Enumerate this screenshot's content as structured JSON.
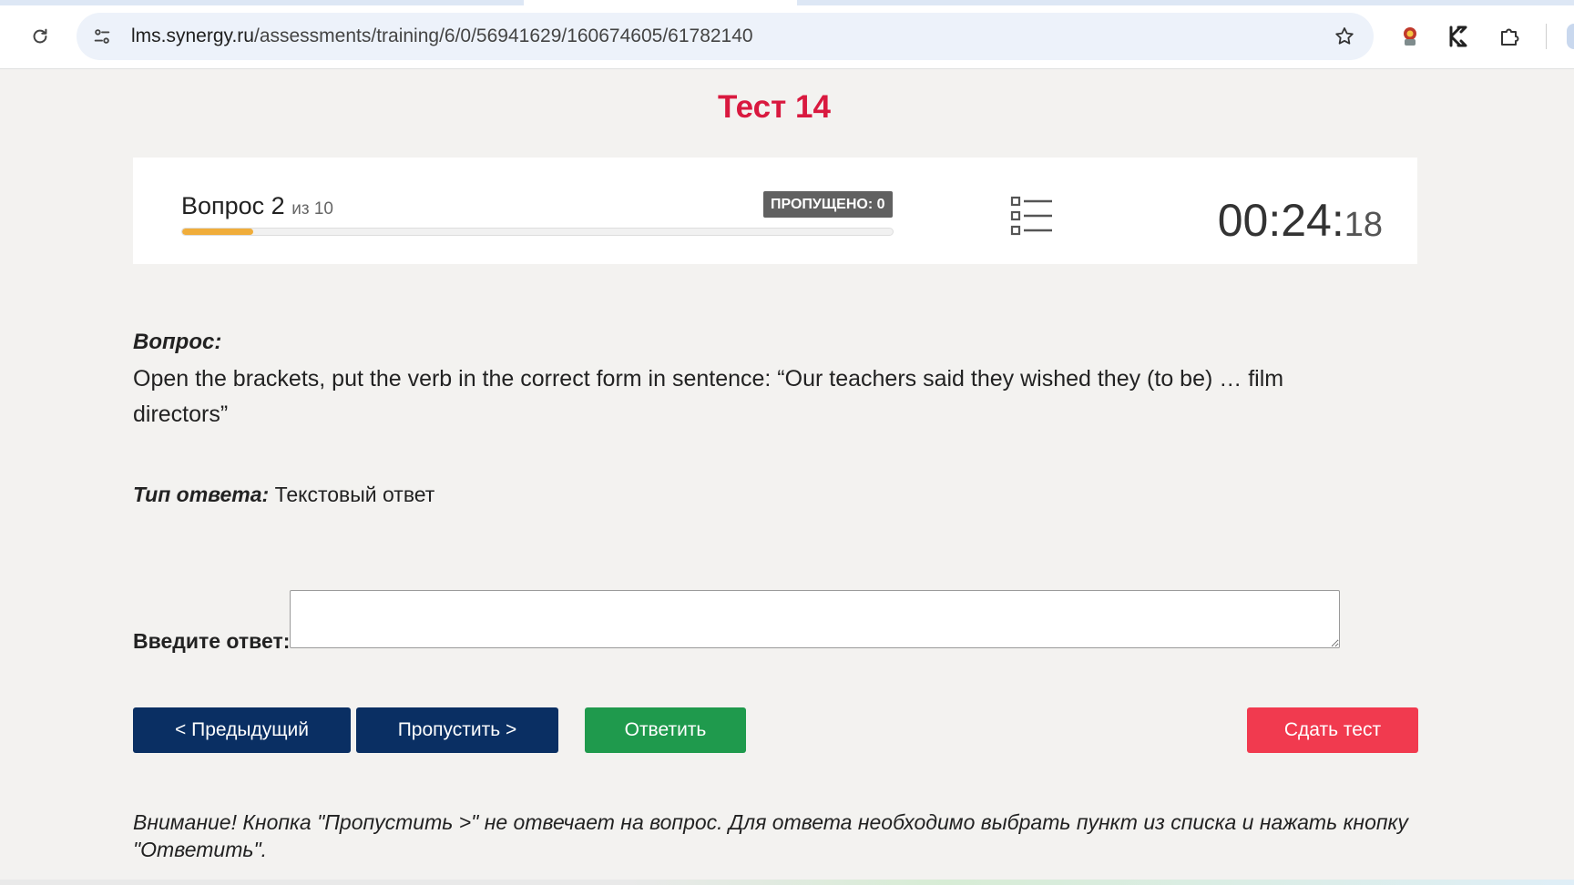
{
  "browser": {
    "url_host": "lms.synergy.ru",
    "url_path": "/assessments/training/6/0/56941629/160674605/61782140",
    "icons": [
      "reload-icon",
      "site-info-icon",
      "bookmark-star-icon",
      "extension-icon",
      "kaspersky-icon",
      "puzzle-icon"
    ]
  },
  "page": {
    "title": "Тест 14",
    "title_color": "#d9193f"
  },
  "header": {
    "question_label": "Вопрос 2",
    "question_of": "из 10",
    "current": 2,
    "total": 10,
    "progress_percent": 10,
    "skipped_label": "ПРОПУЩЕНО: 0",
    "timer_main": "00:24:",
    "timer_seconds": "18"
  },
  "question": {
    "label": "Вопрос:",
    "text": "Open the brackets, put the verb in the correct form in sentence: “Our teachers said they wished they (to be) … film directors”"
  },
  "answer_type": {
    "label": "Тип ответа:",
    "value": "Текстовый ответ"
  },
  "answer": {
    "label": "Введите ответ:",
    "value": ""
  },
  "buttons": {
    "prev": "< Предыдущий",
    "skip": "Пропустить >",
    "answer": "Ответить",
    "submit": "Сдать тест"
  },
  "colors": {
    "primary_navy": "#0a2f63",
    "answer_green": "#1f9a4d",
    "submit_red": "#f13a4f",
    "progress_orange": "#f0ad3b"
  },
  "notice": "Внимание! Кнопка \"Пропустить >\" не отвечает на вопрос. Для ответа необходимо выбрать пункт из списка и нажать кнопку \"Ответить\"."
}
